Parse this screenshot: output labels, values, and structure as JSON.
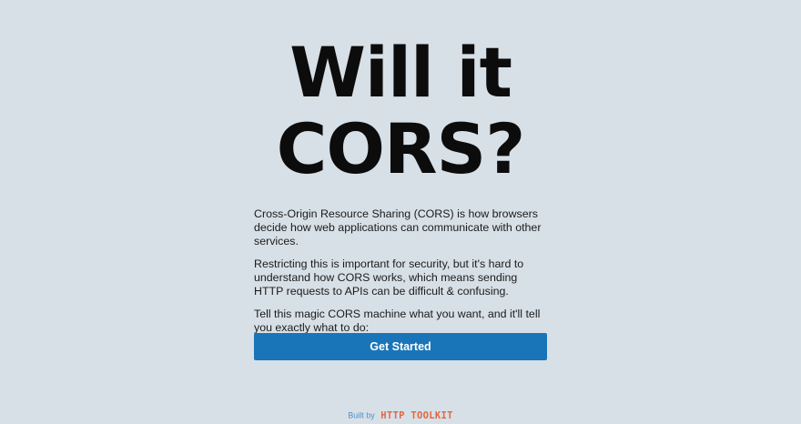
{
  "hero": {
    "title_line1": "Will it",
    "title_line2": "CORS?"
  },
  "intro": {
    "paragraphs": [
      "Cross-Origin Resource Sharing (CORS) is how browsers decide how web applications can communicate with other services.",
      "Restricting this is important for security, but it's hard to understand how CORS works, which means sending HTTP requests to APIs can be difficult & confusing.",
      "Tell this magic CORS machine what you want, and it'll tell you exactly what to do:"
    ]
  },
  "cta": {
    "label": "Get Started"
  },
  "footer": {
    "built_by": "Built by",
    "brand": "HTTP TOOLKIT"
  },
  "colors": {
    "background": "#d8e0e7",
    "button": "#1a75b8",
    "brand_orange": "#e2673f",
    "built_by_blue": "#4f8fc6"
  }
}
